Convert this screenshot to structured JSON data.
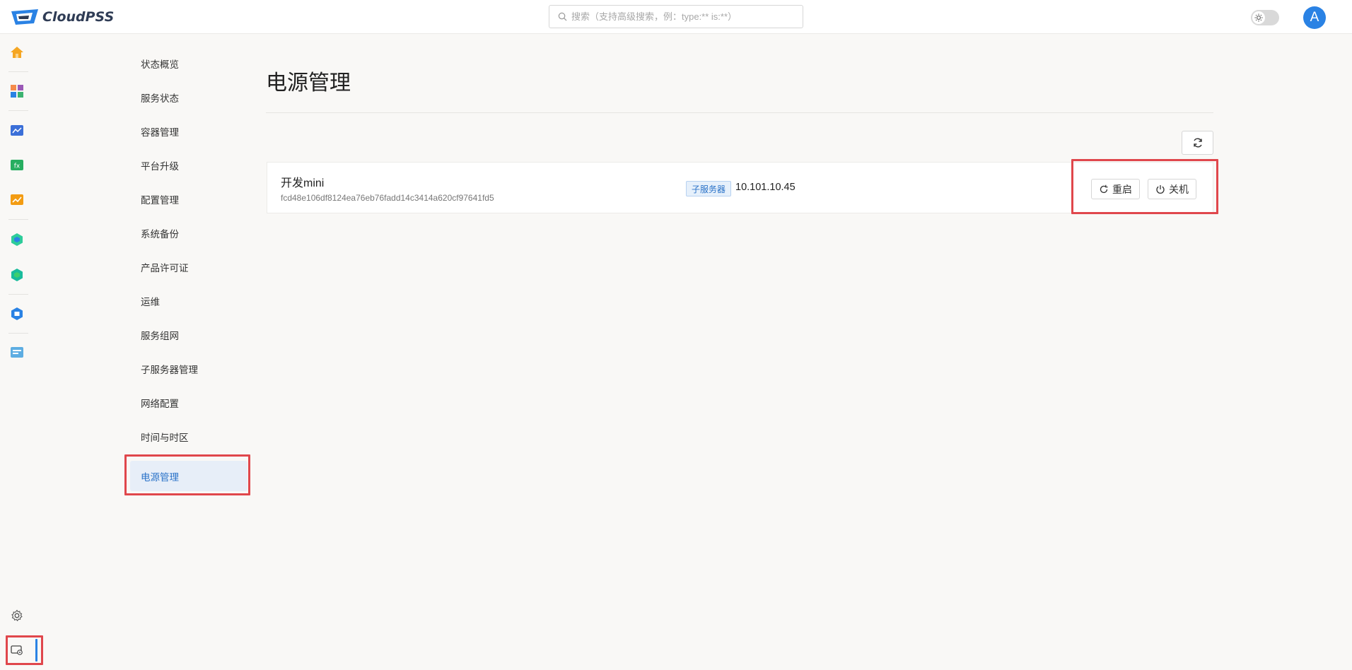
{
  "header": {
    "brand": "CloudPSS",
    "search_placeholder": "搜索（支持高级搜索，例：type:** is:**）",
    "avatar_letter": "A"
  },
  "rail": {
    "icons": [
      "home-icon",
      "apps-grid-icon",
      "simulation-icon",
      "function-icon",
      "chart-icon",
      "model-icon",
      "model-alt-icon",
      "hub-icon",
      "document-icon",
      "settings-icon",
      "system-admin-icon"
    ],
    "active": "system-admin-icon"
  },
  "subnav": {
    "items": [
      {
        "label": "状态概览"
      },
      {
        "label": "服务状态"
      },
      {
        "label": "容器管理"
      },
      {
        "label": "平台升级"
      },
      {
        "label": "配置管理"
      },
      {
        "label": "系统备份"
      },
      {
        "label": "产品许可证"
      },
      {
        "label": "运维"
      },
      {
        "label": "服务组网"
      },
      {
        "label": "子服务器管理"
      },
      {
        "label": "网络配置"
      },
      {
        "label": "时间与时区"
      },
      {
        "label": "电源管理"
      }
    ],
    "active_index": 12
  },
  "main": {
    "title": "电源管理",
    "server": {
      "name": "开发mini",
      "id": "fcd48e106df8124ea76eb76fadd14c3414a620cf97641fd5",
      "tag": "子服务器",
      "ip": "10.101.10.45",
      "restart_label": "重启",
      "shutdown_label": "关机"
    }
  },
  "colors": {
    "accent": "#2a82e4",
    "highlight": "#e0474c",
    "background": "#f9f8f6"
  }
}
